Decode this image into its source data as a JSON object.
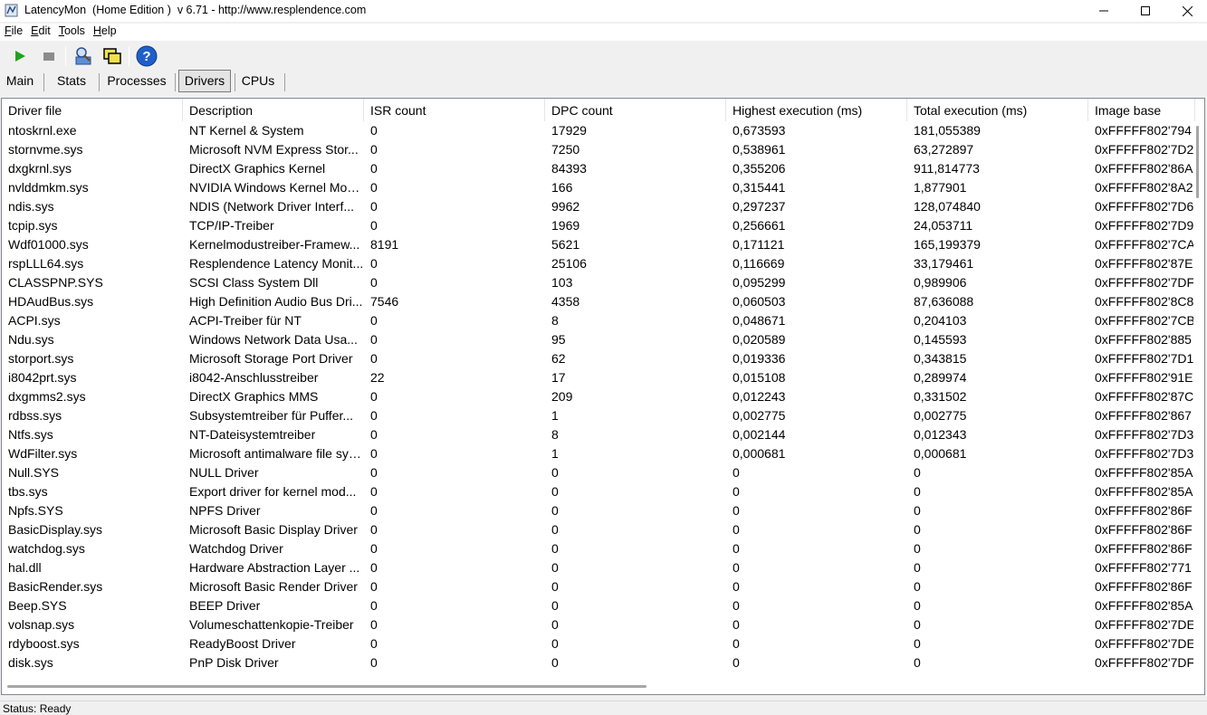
{
  "window": {
    "title": "LatencyMon  (Home Edition )  v 6.71 - http://www.resplendence.com"
  },
  "menu": [
    {
      "label": "File",
      "accel": "F",
      "rest": "ile"
    },
    {
      "label": "Edit",
      "accel": "E",
      "rest": "dit"
    },
    {
      "label": "Tools",
      "accel": "T",
      "rest": "ools"
    },
    {
      "label": "Help",
      "accel": "H",
      "rest": "elp"
    }
  ],
  "toolbar": {
    "icons": [
      "play-icon",
      "stop-icon",
      "inspect-icon",
      "windows-icon",
      "help-icon"
    ],
    "colors": {
      "play": "#1fa31f",
      "stop": "#8c8c8c",
      "help": "#1f5fc9"
    }
  },
  "tabs": [
    {
      "label": "Main",
      "active": false
    },
    {
      "label": "Stats",
      "active": false
    },
    {
      "label": "Processes",
      "active": false
    },
    {
      "label": "Drivers",
      "active": true
    },
    {
      "label": "CPUs",
      "active": false
    }
  ],
  "table": {
    "columns": [
      "Driver file",
      "Description",
      "ISR count",
      "DPC count",
      "Highest execution (ms)",
      "Total execution (ms)",
      "Image base"
    ],
    "rows": [
      [
        "ntoskrnl.exe",
        "NT Kernel & System",
        "0",
        "17929",
        "0,673593",
        "181,055389",
        "0xFFFFF802'794"
      ],
      [
        "stornvme.sys",
        "Microsoft NVM Express Stor...",
        "0",
        "7250",
        "0,538961",
        "63,272897",
        "0xFFFFF802'7D2"
      ],
      [
        "dxgkrnl.sys",
        "DirectX Graphics Kernel",
        "0",
        "84393",
        "0,355206",
        "911,814773",
        "0xFFFFF802'86A"
      ],
      [
        "nvlddmkm.sys",
        "NVIDIA Windows Kernel Mod...",
        "0",
        "166",
        "0,315441",
        "1,877901",
        "0xFFFFF802'8A2"
      ],
      [
        "ndis.sys",
        "NDIS (Network Driver Interf...",
        "0",
        "9962",
        "0,297237",
        "128,074840",
        "0xFFFFF802'7D6"
      ],
      [
        "tcpip.sys",
        "TCP/IP-Treiber",
        "0",
        "1969",
        "0,256661",
        "24,053711",
        "0xFFFFF802'7D9"
      ],
      [
        "Wdf01000.sys",
        "Kernelmodustreiber-Framew...",
        "8191",
        "5621",
        "0,171121",
        "165,199379",
        "0xFFFFF802'7CA"
      ],
      [
        "rspLLL64.sys",
        "Resplendence Latency Monit...",
        "0",
        "25106",
        "0,116669",
        "33,179461",
        "0xFFFFF802'87E"
      ],
      [
        "CLASSPNP.SYS",
        "SCSI Class System Dll",
        "0",
        "103",
        "0,095299",
        "0,989906",
        "0xFFFFF802'7DF"
      ],
      [
        "HDAudBus.sys",
        "High Definition Audio Bus Dri...",
        "7546",
        "4358",
        "0,060503",
        "87,636088",
        "0xFFFFF802'8C8"
      ],
      [
        "ACPI.sys",
        "ACPI-Treiber für NT",
        "0",
        "8",
        "0,048671",
        "0,204103",
        "0xFFFFF802'7CB"
      ],
      [
        "Ndu.sys",
        "Windows Network Data Usa...",
        "0",
        "95",
        "0,020589",
        "0,145593",
        "0xFFFFF802'885"
      ],
      [
        "storport.sys",
        "Microsoft Storage Port Driver",
        "0",
        "62",
        "0,019336",
        "0,343815",
        "0xFFFFF802'7D1"
      ],
      [
        "i8042prt.sys",
        "i8042-Anschlusstreiber",
        "22",
        "17",
        "0,015108",
        "0,289974",
        "0xFFFFF802'91E"
      ],
      [
        "dxgmms2.sys",
        "DirectX Graphics MMS",
        "0",
        "209",
        "0,012243",
        "0,331502",
        "0xFFFFF802'87C"
      ],
      [
        "rdbss.sys",
        "Subsystemtreiber für Puffer...",
        "0",
        "1",
        "0,002775",
        "0,002775",
        "0xFFFFF802'867"
      ],
      [
        "Ntfs.sys",
        "NT-Dateisystemtreiber",
        "0",
        "8",
        "0,002144",
        "0,012343",
        "0xFFFFF802'7D3"
      ],
      [
        "WdFilter.sys",
        "Microsoft antimalware file sys...",
        "0",
        "1",
        "0,000681",
        "0,000681",
        "0xFFFFF802'7D3"
      ],
      [
        "Null.SYS",
        "NULL Driver",
        "0",
        "0",
        "0",
        "0",
        "0xFFFFF802'85A"
      ],
      [
        "tbs.sys",
        "Export driver for kernel mod...",
        "0",
        "0",
        "0",
        "0",
        "0xFFFFF802'85A"
      ],
      [
        "Npfs.SYS",
        "NPFS Driver",
        "0",
        "0",
        "0",
        "0",
        "0xFFFFF802'86F"
      ],
      [
        "BasicDisplay.sys",
        "Microsoft Basic Display Driver",
        "0",
        "0",
        "0",
        "0",
        "0xFFFFF802'86F"
      ],
      [
        "watchdog.sys",
        "Watchdog Driver",
        "0",
        "0",
        "0",
        "0",
        "0xFFFFF802'86F"
      ],
      [
        "hal.dll",
        "Hardware Abstraction Layer ...",
        "0",
        "0",
        "0",
        "0",
        "0xFFFFF802'771"
      ],
      [
        "BasicRender.sys",
        "Microsoft Basic Render Driver",
        "0",
        "0",
        "0",
        "0",
        "0xFFFFF802'86F"
      ],
      [
        "Beep.SYS",
        "BEEP Driver",
        "0",
        "0",
        "0",
        "0",
        "0xFFFFF802'85A"
      ],
      [
        "volsnap.sys",
        "Volumeschattenkopie-Treiber",
        "0",
        "0",
        "0",
        "0",
        "0xFFFFF802'7DE"
      ],
      [
        "rdyboost.sys",
        "ReadyBoost Driver",
        "0",
        "0",
        "0",
        "0",
        "0xFFFFF802'7DE"
      ],
      [
        "disk.sys",
        "PnP Disk Driver",
        "0",
        "0",
        "0",
        "0",
        "0xFFFFF802'7DF"
      ]
    ]
  },
  "status": {
    "text": "Status: Ready"
  }
}
